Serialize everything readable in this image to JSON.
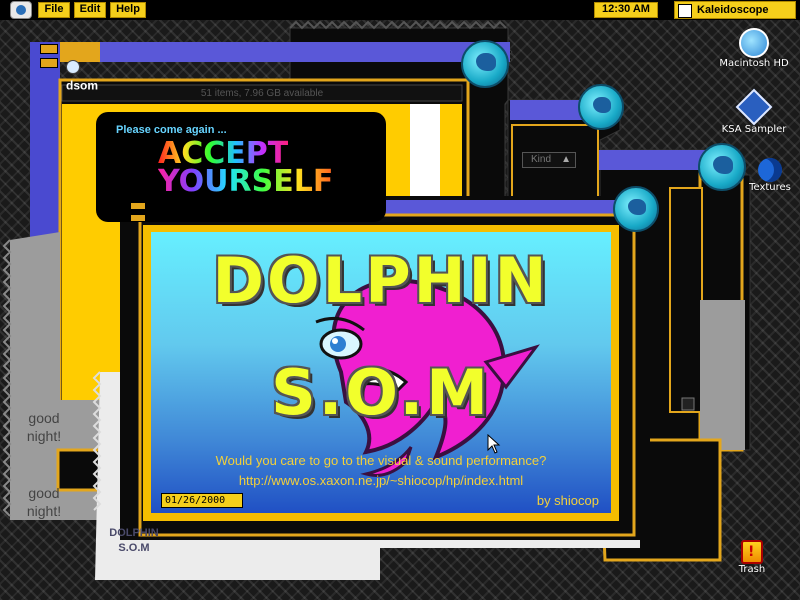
{
  "menubar": {
    "items": [
      "File",
      "Edit",
      "Help"
    ],
    "clock": "12:30 AM",
    "app_name": "Kaleidoscope"
  },
  "windows": {
    "dsom": {
      "title": "dsom",
      "info": "51 items, 7.96 GB available",
      "banner_top": "Please come again ...",
      "banner_line1": "ACCEPT",
      "banner_line2": "YOURSELF"
    },
    "list_window": {
      "column_header": "Kind"
    }
  },
  "main_window": {
    "title_line1": "DOLPHIN",
    "title_line2": "S.O.M",
    "question": "Would you care to go to the visual & sound performance?",
    "url": "http://www.os.xaxon.ne.jp/~shiocop/hp/index.html",
    "byline": "by shiocop",
    "date": "01/26/2000"
  },
  "desktop_texts": {
    "goodnight_1": [
      "good",
      "night!"
    ],
    "goodnight_2": [
      "good",
      "night!"
    ],
    "dolphin_som": [
      "DOLPHIN",
      "S.O.M"
    ]
  },
  "desktop_icons": [
    {
      "label": "Macintosh HD",
      "icon": "hard-disk-icon"
    },
    {
      "label": "KSA Sampler",
      "icon": "app-icon"
    },
    {
      "label": "Textures",
      "icon": "folder-icon"
    },
    {
      "label": "Trash",
      "icon": "trash-icon"
    }
  ],
  "colors": {
    "accent_yellow": "#f5cf1b",
    "window_frame_orange": "#e3a61c",
    "window_blue": "#5a58d8",
    "dolphin_pink": "#f01fd0"
  }
}
